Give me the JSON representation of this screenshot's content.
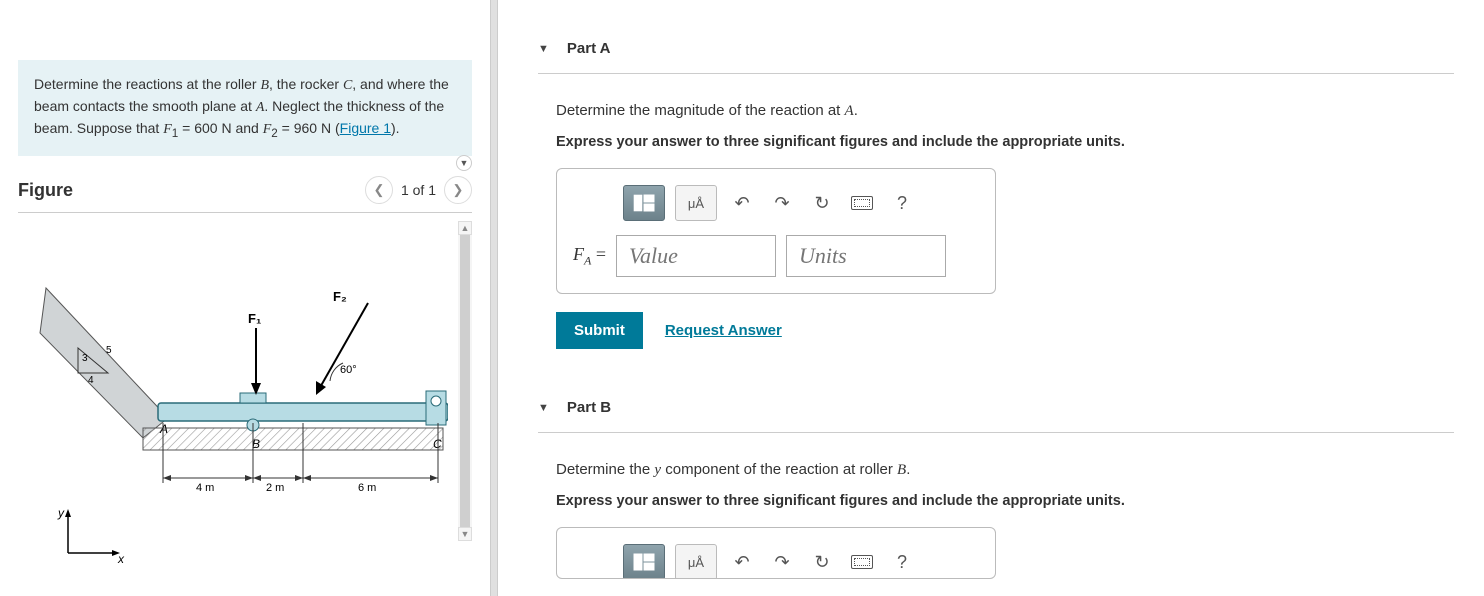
{
  "problem": {
    "line1_pre": "Determine the reactions at the roller ",
    "B": "B",
    "line1_mid": ", the rocker ",
    "C": "C",
    "line1_post": ", and where the beam contacts the smooth plane at ",
    "A": "A",
    "line1_end": ". Neglect the thickness of the beam. Suppose that ",
    "F1_label": "F",
    "F1_sub": "1",
    "F1_val": " = 600 N",
    "and": " and ",
    "F2_label": "F",
    "F2_sub": "2",
    "F2_val": " = 960 N",
    "space": " ",
    "open": "(",
    "figlink": "Figure 1",
    "close": ")."
  },
  "figure": {
    "title": "Figure",
    "nav_count": "1 of 1",
    "labels": {
      "F1": "F₁",
      "F2": "F₂",
      "angle": "60°",
      "A": "A",
      "B": "B",
      "C": "C",
      "d1": "4 m",
      "d2": "2 m",
      "d3": "6 m",
      "s3": "3",
      "s4": "4",
      "s5": "5",
      "y": "y",
      "x": "x"
    }
  },
  "partA": {
    "title": "Part A",
    "prompt_pre": "Determine the magnitude of the reaction at ",
    "prompt_var": "A",
    "prompt_post": ".",
    "instruct": "Express your answer to three significant figures and include the appropriate units.",
    "var": "F",
    "var_sub": "A",
    "eq": " = ",
    "value_ph": "Value",
    "units_ph": "Units",
    "submit": "Submit",
    "request": "Request Answer",
    "tool_units": "μÅ",
    "tool_help": "?"
  },
  "partB": {
    "title": "Part B",
    "prompt_pre": "Determine the ",
    "prompt_y": "y",
    "prompt_mid": " component of the reaction at roller ",
    "prompt_var": "B",
    "prompt_post": ".",
    "instruct": "Express your answer to three significant figures and include the appropriate units.",
    "tool_help": "?"
  }
}
